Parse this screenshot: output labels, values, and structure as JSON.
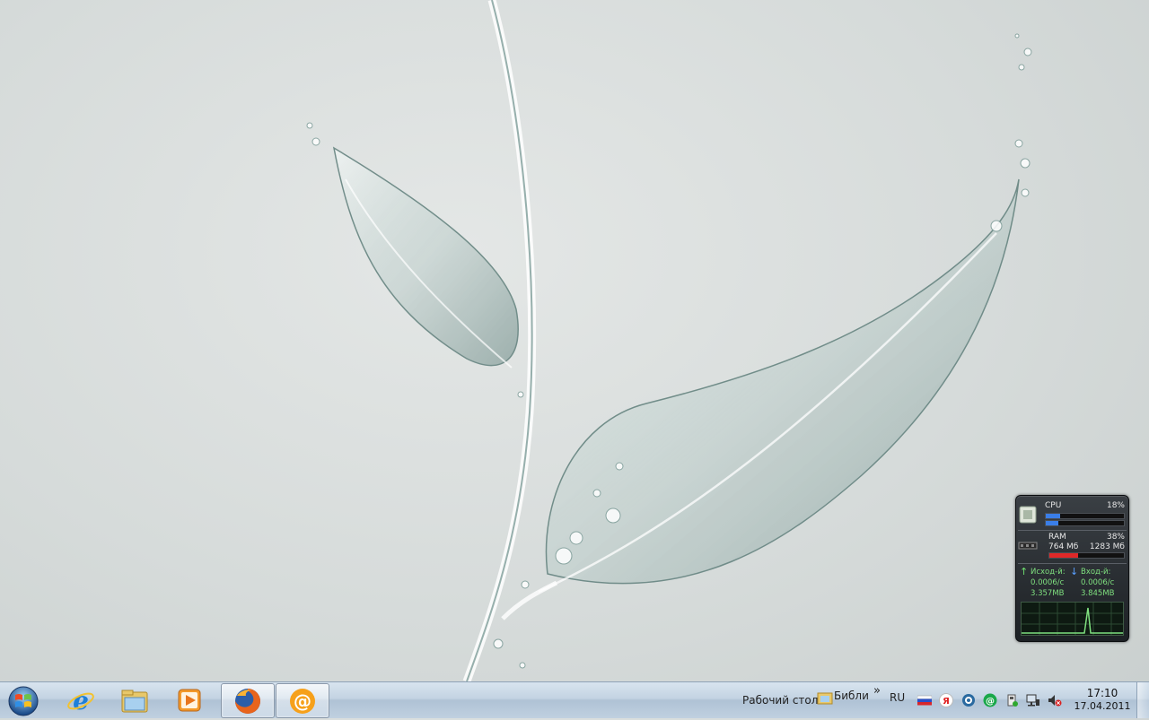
{
  "gadget": {
    "cpu_label": "CPU",
    "cpu_percent": "18%",
    "cpu_core1_fraction": 0.18,
    "cpu_core2_fraction": 0.16,
    "ram_label": "RAM",
    "ram_percent": "38%",
    "ram_used": "764 Мб",
    "ram_total": "1283 Мб",
    "ram_fraction": 0.38,
    "upload_label": "Исход-й:",
    "upload_rate": "0.0006/с",
    "upload_total": "3.357MB",
    "download_label": "Вход-й:",
    "download_rate": "0.0006/с",
    "download_total": "3.845MB",
    "colors": {
      "cpu_bar": "#3a7ee8",
      "ram_bar": "#e02828",
      "net_text": "#7fe07f"
    }
  },
  "taskbar": {
    "pinned": [
      {
        "name": "internet-explorer-icon"
      },
      {
        "name": "windows-explorer-icon"
      },
      {
        "name": "media-player-icon"
      },
      {
        "name": "firefox-icon"
      },
      {
        "name": "mail-agent-icon"
      }
    ],
    "toolbar_desktop": "Рабочий стол",
    "toolbar_libraries": "Библи",
    "toolbar_overflow": "»",
    "language": "RU",
    "clock_time": "17:10",
    "clock_date": "17.04.2011"
  }
}
